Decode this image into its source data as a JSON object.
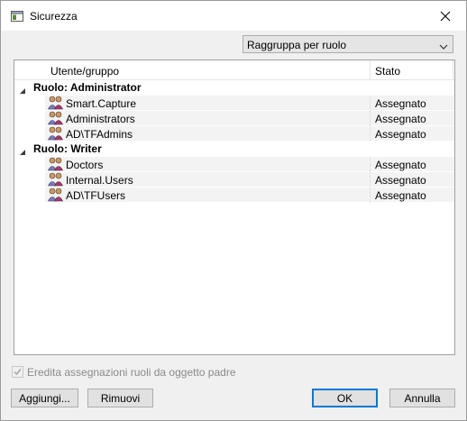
{
  "window": {
    "title": "Sicurezza"
  },
  "toolbar": {
    "group_by": "Raggruppa per ruolo"
  },
  "columns": {
    "user_group": "Utente/gruppo",
    "state": "Stato"
  },
  "groups": [
    {
      "label": "Ruolo: Administrator",
      "members": [
        {
          "name": "Smart.Capture",
          "state": "Assegnato"
        },
        {
          "name": "Administrators",
          "state": "Assegnato"
        },
        {
          "name": "AD\\TFAdmins",
          "state": "Assegnato"
        }
      ]
    },
    {
      "label": "Ruolo: Writer",
      "members": [
        {
          "name": "Doctors",
          "state": "Assegnato"
        },
        {
          "name": "Internal.Users",
          "state": "Assegnato"
        },
        {
          "name": "AD\\TFUsers",
          "state": "Assegnato"
        }
      ]
    }
  ],
  "inherit": {
    "label": "Eredita assegnazioni ruoli da oggetto padre",
    "checked": true,
    "enabled": false
  },
  "buttons": {
    "add": "Aggiungi...",
    "remove": "Rimuovi",
    "ok": "OK",
    "cancel": "Annulla"
  },
  "colors": {
    "accent": "#0078d7",
    "row_bg": "#f3f3f3",
    "dialog_bg": "#f0f0f0"
  },
  "icons": {
    "app": "window-icon",
    "close": "close-icon",
    "dropdown": "chevron-down-icon",
    "collapse": "collapse-triangle-icon",
    "member": "user-group-icon"
  }
}
